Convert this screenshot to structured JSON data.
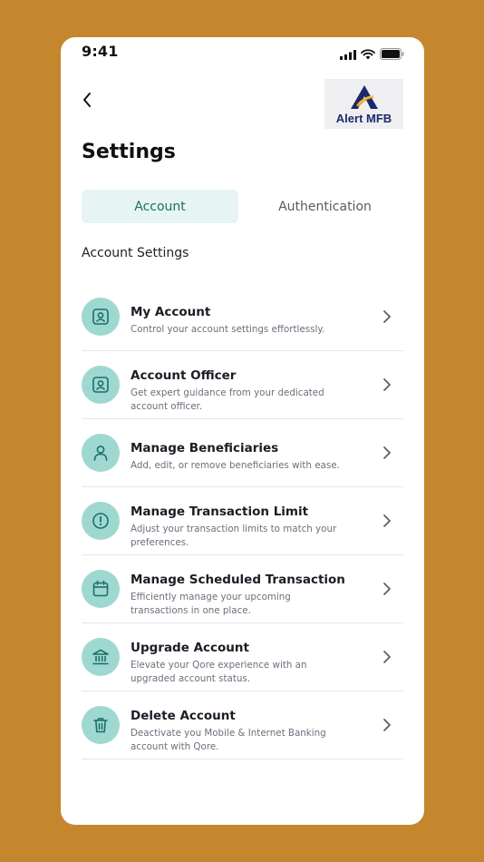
{
  "status_bar": {
    "time": "9:41"
  },
  "header": {
    "back_icon": "chevron-left-icon",
    "logo_text": "Alert MFB",
    "title": "Settings"
  },
  "tabs": [
    {
      "label": "Account",
      "active": true
    },
    {
      "label": "Authentication",
      "active": false
    }
  ],
  "section_title": "Account Settings",
  "items": [
    {
      "icon": "account-card-icon",
      "label": "My Account",
      "description": "Control your account settings effortlessly."
    },
    {
      "icon": "account-card-icon",
      "label": "Account Officer",
      "description": "Get expert guidance from your dedicated account officer."
    },
    {
      "icon": "user-icon",
      "label": "Manage Beneficiaries",
      "description": "Add, edit, or remove beneficiaries with ease."
    },
    {
      "icon": "alert-circle-icon",
      "label": "Manage Transaction Limit",
      "description": "Adjust your transaction limits to match your preferences."
    },
    {
      "icon": "calendar-icon",
      "label": "Manage Scheduled Transaction",
      "description": "Efficiently manage your upcoming transactions in one place."
    },
    {
      "icon": "bank-icon",
      "label": "Upgrade Account",
      "description": "Elevate your Qore experience with an upgraded account status."
    },
    {
      "icon": "trash-icon",
      "label": "Delete Account",
      "description": "Deactivate you Mobile & Internet Banking account with Qore."
    }
  ],
  "colors": {
    "background": "#C5872D",
    "accent": "#1B6F67",
    "icon_circle": "#9ED8D1",
    "tab_active_bg": "#E6F4F3"
  }
}
